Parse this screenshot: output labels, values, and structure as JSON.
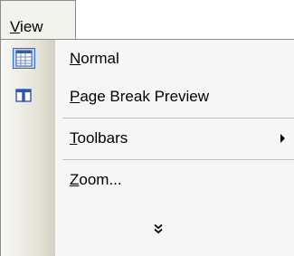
{
  "menubar": {
    "view": {
      "mnemonic": "V",
      "rest": "iew"
    }
  },
  "menu": {
    "items": [
      {
        "mnemonic": "N",
        "rest": "ormal",
        "icon": "normal-view-icon",
        "selected": true
      },
      {
        "mnemonic": "P",
        "rest": "age Break Preview",
        "icon": "page-break-preview-icon"
      },
      {
        "mnemonic": "T",
        "rest": "oolbars",
        "submenu": true
      },
      {
        "mnemonic": "Z",
        "rest": "oom..."
      }
    ],
    "expand_icon": "expand-chevron-icon"
  },
  "colors": {
    "selection_fill": "#c1d2ee",
    "selection_border": "#316ac5",
    "menu_background": "#f6f6f6"
  }
}
